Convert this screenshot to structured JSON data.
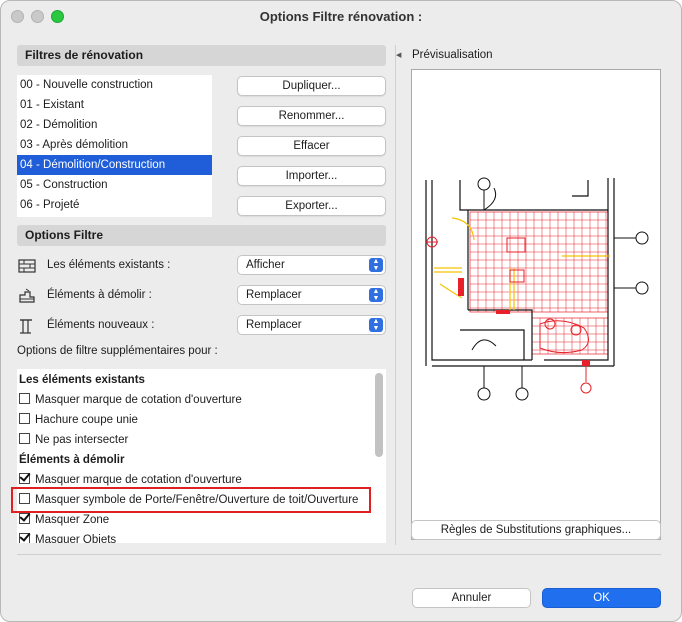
{
  "window": {
    "title": "Options Filtre rénovation :"
  },
  "filters": {
    "header": "Filtres de rénovation",
    "items": [
      "00 - Nouvelle construction",
      "01 - Existant",
      "02 - Démolition",
      "03 - Après démolition",
      "04 - Démolition/Construction",
      "05 - Construction",
      "06 - Projeté"
    ],
    "selected_index": 4
  },
  "actions": {
    "dupliquer": "Dupliquer...",
    "renommer": "Renommer...",
    "effacer": "Effacer",
    "importer": "Importer...",
    "exporter": "Exporter..."
  },
  "options": {
    "header": "Options Filtre",
    "rows": [
      {
        "label": "Les éléments existants :",
        "value": "Afficher",
        "icon": "existing-elements-icon"
      },
      {
        "label": "Éléments à démolir :",
        "value": "Remplacer",
        "icon": "demolish-elements-icon"
      },
      {
        "label": "Éléments nouveaux :",
        "value": "Remplacer",
        "icon": "new-elements-icon"
      }
    ],
    "note": "Options de filtre supplémentaires pour :"
  },
  "extra": {
    "group1": {
      "title": "Les éléments existants",
      "items": [
        {
          "label": "Masquer marque de cotation d'ouverture",
          "checked": false
        },
        {
          "label": "Hachure coupe unie",
          "checked": false
        },
        {
          "label": "Ne pas intersecter",
          "checked": false
        }
      ]
    },
    "group2": {
      "title": "Éléments à démolir",
      "items": [
        {
          "label": "Masquer marque de cotation d'ouverture",
          "checked": true
        },
        {
          "label": "Masquer symbole de Porte/Fenêtre/Ouverture de toit/Ouverture",
          "checked": false
        },
        {
          "label": "Masquer Zone",
          "checked": true
        },
        {
          "label": "Masquer Objets",
          "checked": true
        }
      ]
    }
  },
  "preview": {
    "label": "Prévisualisation",
    "button": "Règles de Substitutions graphiques...",
    "accent_red": "#e8202a",
    "accent_yellow": "#f3c400"
  },
  "footer": {
    "cancel": "Annuler",
    "ok": "OK"
  },
  "colors": {
    "selection": "#1f5ed8",
    "ok_button": "#1f6fef",
    "highlight": "#e02020"
  }
}
